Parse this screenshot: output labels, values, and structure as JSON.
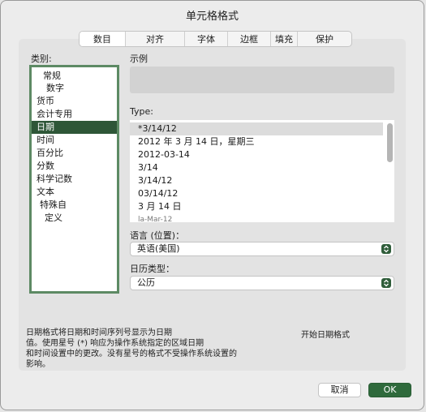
{
  "window": {
    "title": "单元格格式"
  },
  "tabs": [
    {
      "label": "数目",
      "active": true
    },
    {
      "label": "对齐",
      "active": false
    },
    {
      "label": "字体",
      "active": false
    },
    {
      "label": "边框",
      "active": false
    },
    {
      "label": "填充",
      "active": false
    },
    {
      "label": "保护",
      "active": false
    }
  ],
  "category": {
    "label": "类别:",
    "items": [
      {
        "label": "常规",
        "indent": 1
      },
      {
        "label": "数字",
        "indent": 2
      },
      {
        "label": "货币",
        "indent": 0
      },
      {
        "label": "会计专用",
        "indent": 0
      },
      {
        "label": "日期",
        "indent": 0,
        "selected": true
      },
      {
        "label": "时间",
        "indent": 0
      },
      {
        "label": "百分比",
        "indent": 0
      },
      {
        "label": "分数",
        "indent": 0
      },
      {
        "label": "科学记数",
        "indent": 0
      },
      {
        "label": "文本",
        "indent": 0
      },
      {
        "label": "特殊自",
        "indent": 1
      },
      {
        "label": "定义",
        "indent": 2
      }
    ]
  },
  "sample": {
    "label": "示例",
    "value": ""
  },
  "type": {
    "label": "Type:",
    "items": [
      {
        "label": "*3/14/12",
        "selected": true
      },
      {
        "label": "2012 年 3 月 14 日，星期三"
      },
      {
        "label": "2012-03-14"
      },
      {
        "label": "3/14"
      },
      {
        "label": "3/14/12"
      },
      {
        "label": "03/14/12"
      },
      {
        "label": "3 月 14 日"
      },
      {
        "label": "la-Mar-12",
        "faded": true
      }
    ]
  },
  "locale": {
    "label": "语言 (位置)：",
    "value": "英语(美国)"
  },
  "calendar": {
    "label": "日历类型：",
    "value": "公历"
  },
  "description": {
    "lines": [
      "日期格式将日期和时间序列号显示为日期",
      "值。使用星号 (*) 响应为操作系统指定的区域日期",
      "和时间设置中的更改。没有星号的格式不受操作系统设置的",
      "影响。"
    ]
  },
  "start_date": {
    "label": "开始日期格式"
  },
  "buttons": {
    "cancel": "取消",
    "ok": "OK"
  },
  "colors": {
    "selected": "#2e5637",
    "accent": "#2f6a3c"
  }
}
